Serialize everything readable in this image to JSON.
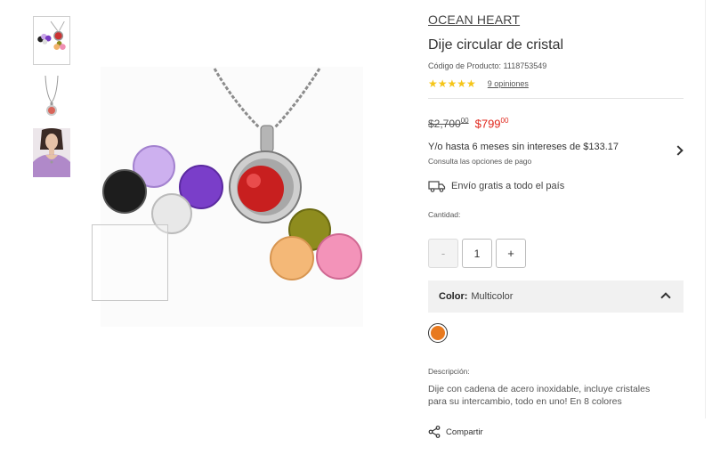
{
  "gallery": {
    "thumbnails": [
      {
        "icon": "pendant-with-stones-thumbnail",
        "active": true
      },
      {
        "icon": "necklace-thumbnail",
        "active": false
      },
      {
        "icon": "model-wearing-necklace-thumbnail",
        "active": false
      }
    ],
    "main_image_icon": "pendant-with-crystals-image"
  },
  "product": {
    "brand": "OCEAN HEART",
    "title": "Dije circular de cristal",
    "sku_text": "Código de Producto: 1118753549",
    "stars": "★★★★★",
    "reviews_link": "9 opiniones",
    "old_price": "$2,700",
    "old_price_cents": "00",
    "new_price": "$799",
    "new_price_cents": "00",
    "installments": "Y/o hasta 6 meses sin intereses de $133.17",
    "installments_sub": "Consulta las opciones de pago",
    "shipping": "Envío gratis a todo el país",
    "quantity_label": "Cantidad:",
    "quantity_value": "1",
    "minus_label": "-",
    "plus_label": "+",
    "color_label": "Color:",
    "color_value": "Multicolor",
    "swatch_color": "#e8791e",
    "description_label": "Descripción:",
    "description": "Dije con cadena de acero inoxidable, incluye cristales para su intercambio, todo en uno! En 8 colores",
    "share_label": "Compartir"
  },
  "colors": {
    "price_red": "#e0261b",
    "star_yellow": "#f5c518"
  }
}
